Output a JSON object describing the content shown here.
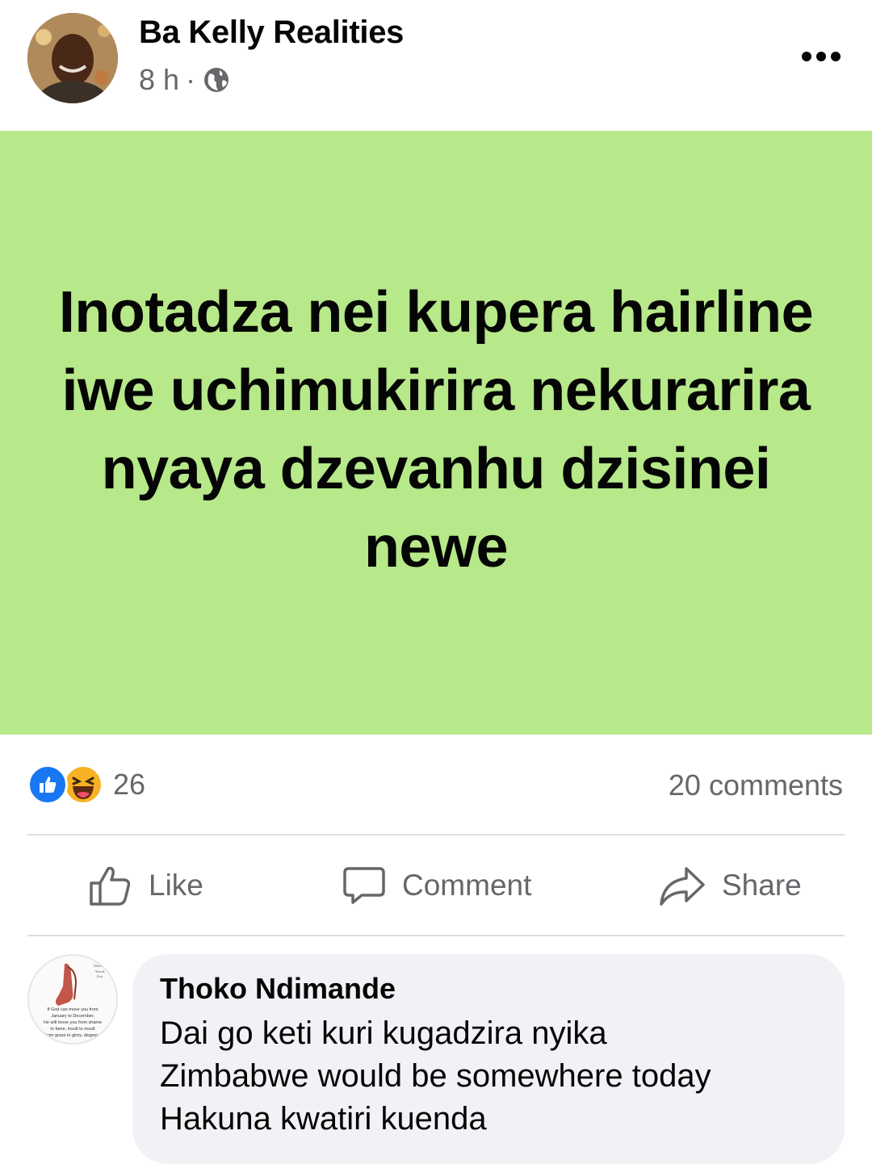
{
  "post": {
    "author": "Ba Kelly Realities",
    "time": "8 h",
    "separator": "·",
    "privacy_icon": "globe-icon",
    "more_icon": "more-options-icon",
    "text": "Inotadza nei kupera hairline iwe uchimukirira nekurarira nyaya dzevanhu dzisinei newe",
    "background_color": "#b7e889"
  },
  "stats": {
    "reaction_icons": [
      "like-reaction-icon",
      "haha-reaction-icon"
    ],
    "reaction_count": "26",
    "comments": "20 comments"
  },
  "actions": {
    "like": "Like",
    "comment": "Comment",
    "share": "Share"
  },
  "comment": {
    "name": "Thoko Ndimande",
    "lines": [
      "Dai go keti kuri kugadzira nyika",
      "Zimbabwe would be somewhere today",
      "Hakuna kwatiri kuenda"
    ],
    "avatar_text": [
      "If God can move you from",
      "January to December,",
      "He will move you from shame",
      "to fame, insult to result",
      "from grass to glory, disgrace"
    ]
  },
  "colors": {
    "like_blue": "#1877f2",
    "haha_yellow": "#f7b125",
    "secondary_text": "#65676b"
  }
}
